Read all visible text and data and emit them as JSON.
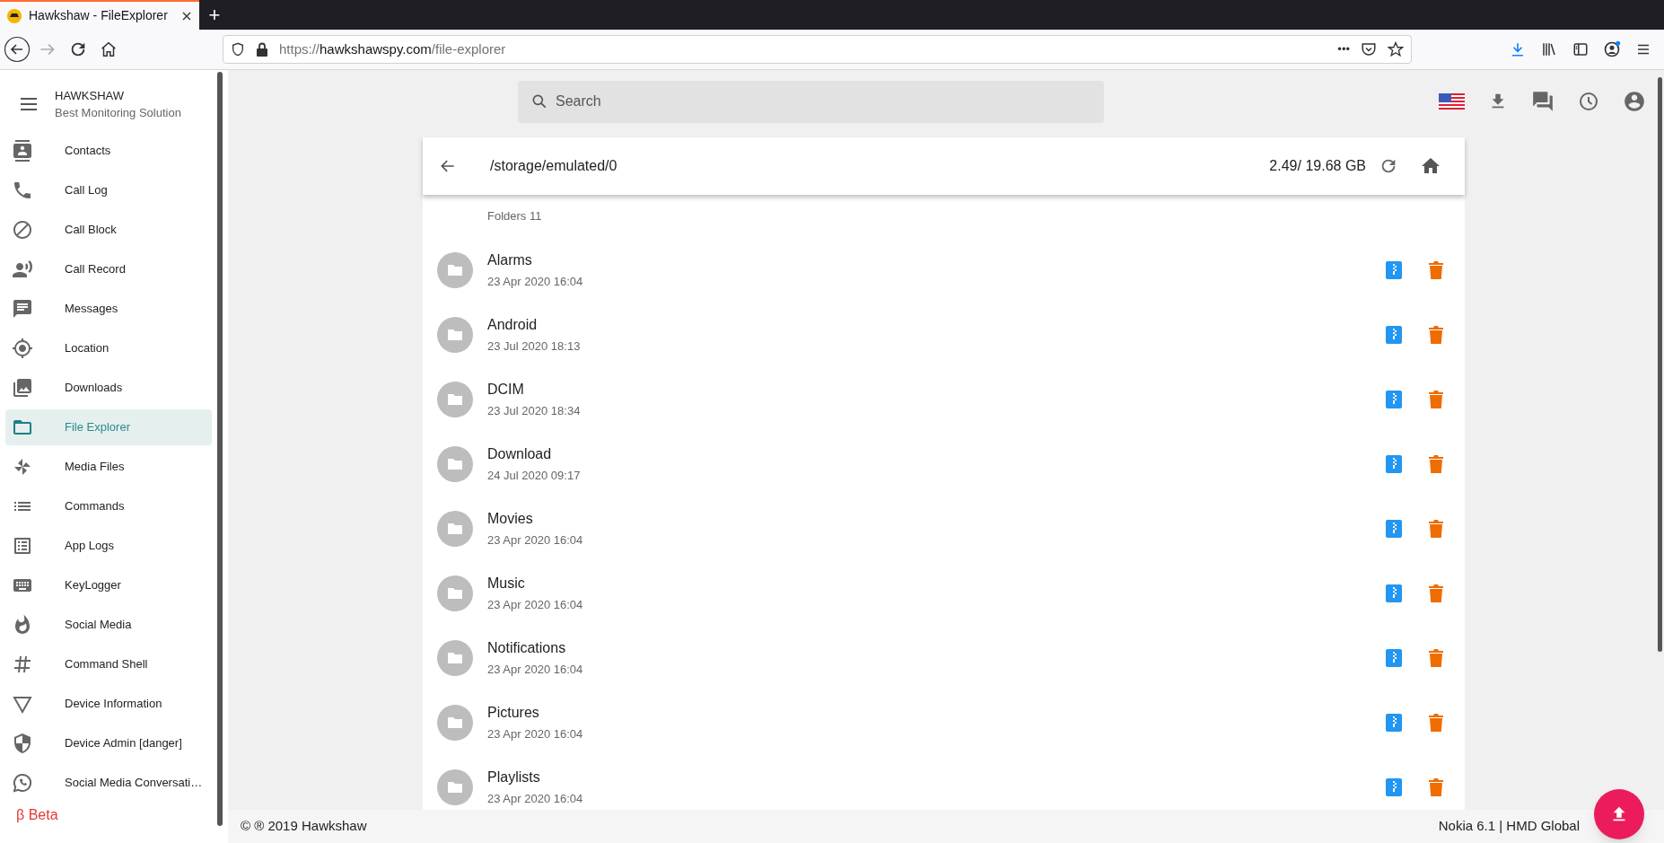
{
  "browser": {
    "tab_title": "Hawkshaw - FileExplorer",
    "new_tab": "+",
    "url_scheme": "https://",
    "url_host": "hawkshawspy.com",
    "url_path": "/file-explorer",
    "page_actions": "•••"
  },
  "sidebar": {
    "brand": "HAWKSHAW",
    "tagline": "Best Monitoring Solution",
    "items": [
      {
        "label": "Contacts",
        "selected": false
      },
      {
        "label": "Call Log",
        "selected": false
      },
      {
        "label": "Call Block",
        "selected": false
      },
      {
        "label": "Call Record",
        "selected": false
      },
      {
        "label": "Messages",
        "selected": false
      },
      {
        "label": "Location",
        "selected": false
      },
      {
        "label": "Downloads",
        "selected": false
      },
      {
        "label": "File Explorer",
        "selected": true
      },
      {
        "label": "Media Files",
        "selected": false
      },
      {
        "label": "Commands",
        "selected": false
      },
      {
        "label": "App Logs",
        "selected": false
      },
      {
        "label": "KeyLogger",
        "selected": false
      },
      {
        "label": "Social Media",
        "selected": false
      },
      {
        "label": "Command Shell",
        "selected": false
      },
      {
        "label": "Device Information",
        "selected": false
      },
      {
        "label": "Device Admin [danger]",
        "selected": false
      },
      {
        "label": "Social Media Conversati…",
        "selected": false
      }
    ],
    "beta_label": "β Beta"
  },
  "search": {
    "placeholder": "Search"
  },
  "explorer": {
    "path": "/storage/emulated/0",
    "storage": "2.49/ 19.68 GB",
    "folders_label": "Folders 11",
    "folders": [
      {
        "name": "Alarms",
        "date": "23 Apr 2020 16:04"
      },
      {
        "name": "Android",
        "date": "23 Jul 2020 18:13"
      },
      {
        "name": "DCIM",
        "date": "23 Jul 2020 18:34"
      },
      {
        "name": "Download",
        "date": "24 Jul 2020 09:17"
      },
      {
        "name": "Movies",
        "date": "23 Apr 2020 16:04"
      },
      {
        "name": "Music",
        "date": "23 Apr 2020 16:04"
      },
      {
        "name": "Notifications",
        "date": "23 Apr 2020 16:04"
      },
      {
        "name": "Pictures",
        "date": "23 Apr 2020 16:04"
      },
      {
        "name": "Playlists",
        "date": "23 Apr 2020 16:04"
      }
    ]
  },
  "footer": {
    "copyright": "© ® 2019 Hawkshaw",
    "device": "Nokia 6.1 | HMD Global"
  }
}
